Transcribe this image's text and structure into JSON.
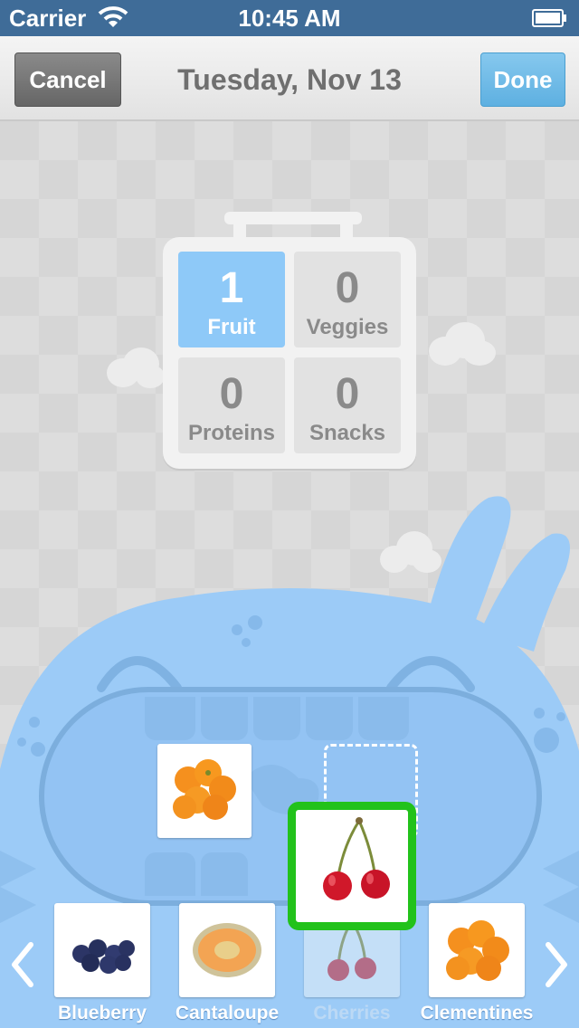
{
  "status_bar": {
    "carrier": "Carrier",
    "time": "10:45 AM"
  },
  "nav": {
    "cancel_label": "Cancel",
    "title": "Tuesday, Nov 13",
    "done_label": "Done"
  },
  "lunchbox": {
    "cells": [
      {
        "count": "1",
        "label": "Fruit",
        "active": true
      },
      {
        "count": "0",
        "label": "Veggies",
        "active": false
      },
      {
        "count": "0",
        "label": "Proteins",
        "active": false
      },
      {
        "count": "0",
        "label": "Snacks",
        "active": false
      }
    ]
  },
  "carousel": {
    "items": [
      {
        "label": "Blueberry",
        "icon": "blueberry-icon"
      },
      {
        "label": "Cantaloupe",
        "icon": "cantaloupe-icon"
      },
      {
        "label": "Cherries",
        "icon": "cherries-icon",
        "dimmed": true
      },
      {
        "label": "Clementines",
        "icon": "clementines-icon"
      }
    ]
  },
  "colors": {
    "accent_blue": "#8ec9f8",
    "selected_green": "#22c21b",
    "status_bar": "#3f6c98",
    "monster": "#9ccbf7"
  }
}
